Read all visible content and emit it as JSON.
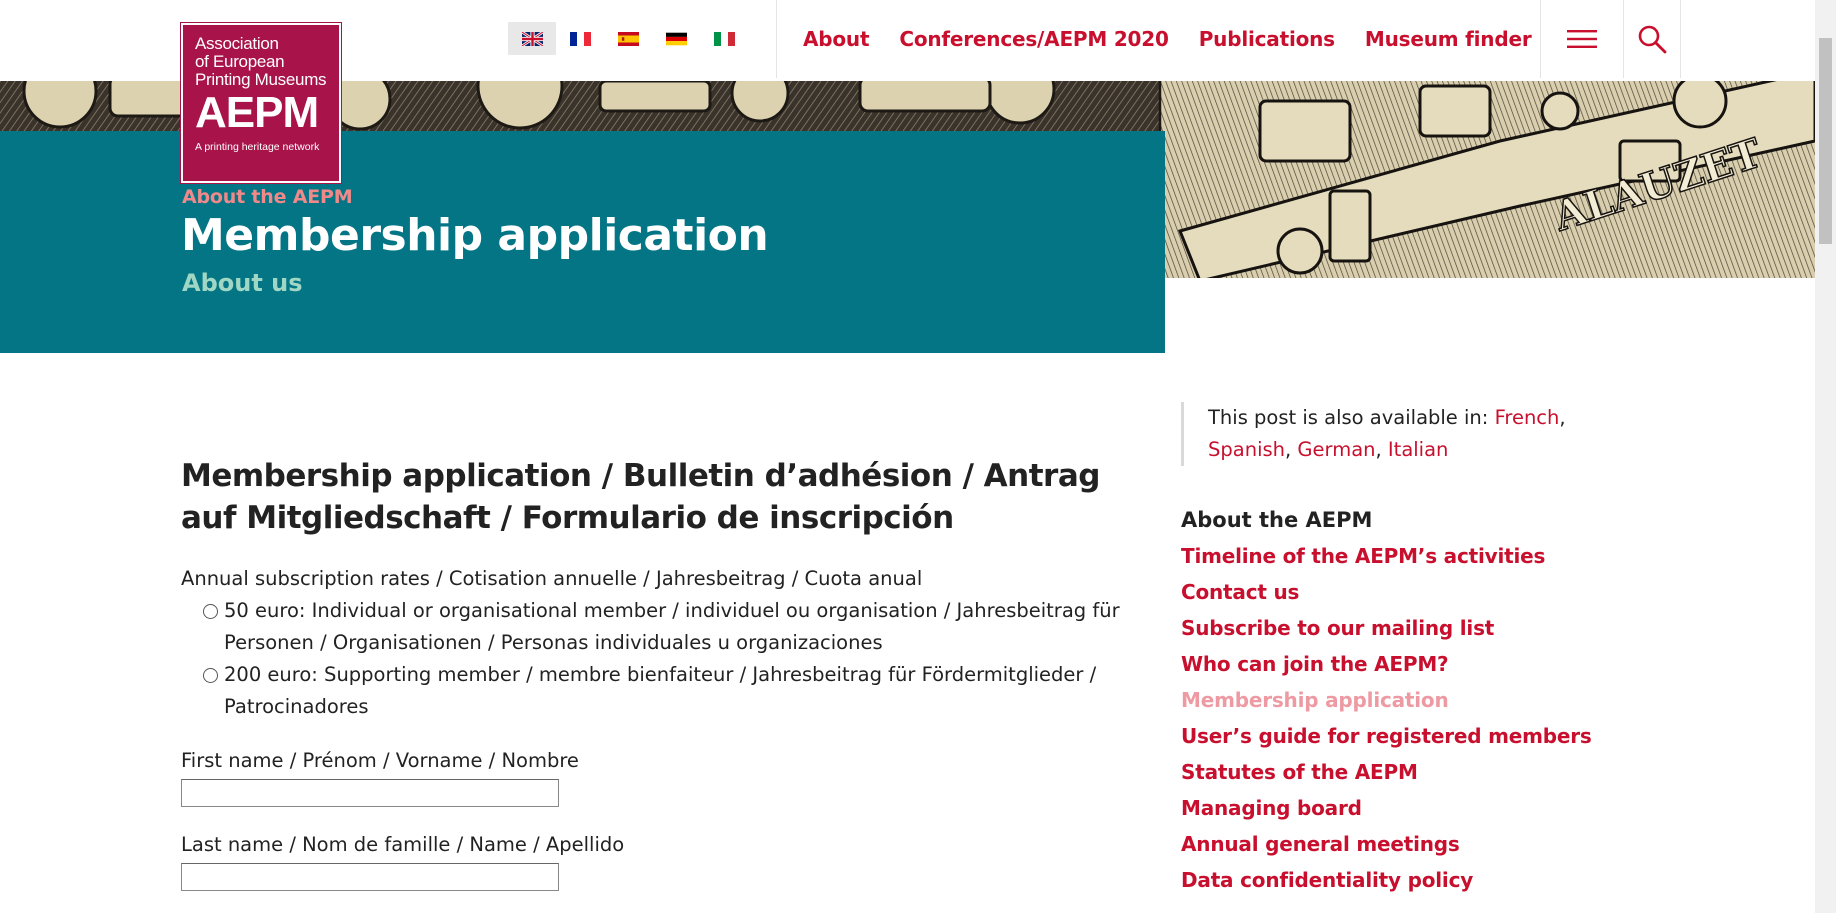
{
  "logo": {
    "line1": "Association",
    "line2": "of European",
    "line3": "Printing Museums",
    "abbr": "AEPM",
    "tagline": "A printing heritage network"
  },
  "languages": [
    {
      "code": "en",
      "label": "English",
      "active": true
    },
    {
      "code": "fr",
      "label": "French"
    },
    {
      "code": "es",
      "label": "Spanish"
    },
    {
      "code": "de",
      "label": "German"
    },
    {
      "code": "it",
      "label": "Italian"
    }
  ],
  "nav": {
    "items": [
      "About",
      "Conferences/AEPM 2020",
      "Publications",
      "Museum finder"
    ],
    "menu_icon": "hamburger-icon",
    "search_icon": "search-icon"
  },
  "hero": {
    "breadcrumb": "About the AEPM",
    "title": "Membership application",
    "subtitle": "About us",
    "image_text": "ALAUZET"
  },
  "main": {
    "title": "Membership application / Bulletin d’adhésion / Antrag auf Mitgliedschaft / Formulario de inscripción",
    "rates_label": "Annual subscription rates / Cotisation annuelle / Jahresbeitrag / Cuota anual",
    "options": [
      "50 euro: Individual or organisational member / individuel ou organisation / Jahresbeitrag für Personen / Organisationen / Personas individuales u organizaciones",
      "200 euro: Supporting member / membre bienfaiteur / Jahresbeitrag für Fördermitglieder / Patrocinadores"
    ],
    "fields": [
      {
        "label": "First name / Prénom / Vorname / Nombre",
        "value": ""
      },
      {
        "label": "Last name / Nom de famille / Name / Apellido",
        "value": ""
      }
    ]
  },
  "sidebar": {
    "lang_notice_prefix": "This post is also available in:",
    "lang_links": [
      "French",
      "Spanish",
      "German",
      "Italian"
    ],
    "heading": "About the AEPM",
    "links": [
      {
        "label": "Timeline of the AEPM’s activities"
      },
      {
        "label": "Contact us"
      },
      {
        "label": "Subscribe to our mailing list"
      },
      {
        "label": "Who can join the AEPM?"
      },
      {
        "label": "Membership application",
        "current": true
      },
      {
        "label": "User’s guide for registered members"
      },
      {
        "label": "Statutes of the AEPM"
      },
      {
        "label": "Managing board"
      },
      {
        "label": "Annual general meetings"
      },
      {
        "label": "Data confidentiality policy"
      }
    ]
  },
  "colors": {
    "brand_red": "#c8102e",
    "logo_bg": "#a8134a",
    "hero_teal": "#047585",
    "breadcrumb_pink": "#f08a8a",
    "subtitle_mint": "#9fd7c4",
    "current_link": "#ed9aa3"
  }
}
